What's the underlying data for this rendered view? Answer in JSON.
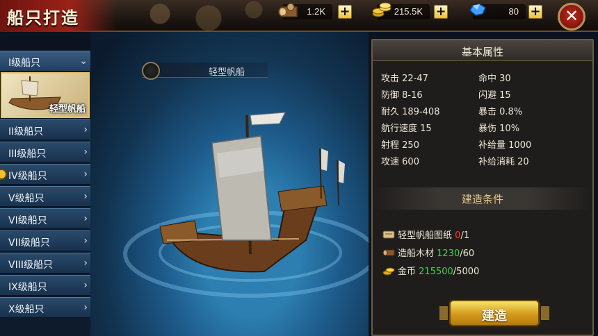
{
  "header": {
    "title": "船只打造"
  },
  "resources": [
    {
      "name": "wood",
      "icon": "wood-log-icon",
      "value": "1.2K"
    },
    {
      "name": "gold",
      "icon": "gold-coins-icon",
      "value": "215.5K"
    },
    {
      "name": "gems",
      "icon": "blue-gem-icon",
      "value": "80"
    }
  ],
  "sidebar": {
    "tiers": [
      {
        "label": "I级船只",
        "chevron": "⌄"
      },
      {
        "label": "II级船只",
        "chevron": "›"
      },
      {
        "label": "III级船只",
        "chevron": "›"
      },
      {
        "label": "IV级船只",
        "chevron": "›"
      },
      {
        "label": "V级船只",
        "chevron": "›"
      },
      {
        "label": "VI级船只",
        "chevron": "›"
      },
      {
        "label": "VII级船只",
        "chevron": "›"
      },
      {
        "label": "VIII级船只",
        "chevron": "›"
      },
      {
        "label": "IX级船只",
        "chevron": "›"
      },
      {
        "label": "X级船只",
        "chevron": "›"
      }
    ],
    "selected_ship": "轻型帆船"
  },
  "stage": {
    "ship_name": "轻型帆船"
  },
  "panel": {
    "title": "基本属性",
    "attrs_left": [
      {
        "key": "攻击",
        "value": "22-47"
      },
      {
        "key": "防御",
        "value": "8-16"
      },
      {
        "key": "耐久",
        "value": "189-408"
      },
      {
        "key": "航行速度",
        "value": "15"
      },
      {
        "key": "射程",
        "value": "250"
      },
      {
        "key": "攻速",
        "value": "600"
      }
    ],
    "attrs_right": [
      {
        "key": "命中",
        "value": "30"
      },
      {
        "key": "闪避",
        "value": "15"
      },
      {
        "key": "暴击",
        "value": "0.8%"
      },
      {
        "key": "暴伤",
        "value": "10%"
      },
      {
        "key": "补给量",
        "value": "1000"
      },
      {
        "key": "补给消耗",
        "value": "20"
      }
    ],
    "build_title": "建造条件",
    "requirements": [
      {
        "icon": "blueprint-scroll-icon",
        "label": "轻型帆船图纸",
        "have": "0",
        "need": "/1",
        "status": "insufficient"
      },
      {
        "icon": "wood-log-icon",
        "label": "造船木材",
        "have": "1230",
        "need": "/60",
        "status": "sufficient"
      },
      {
        "icon": "gold-coins-icon",
        "label": "金币",
        "have": "215500",
        "need": "/5000",
        "status": "sufficient"
      }
    ],
    "build_button": "建造"
  }
}
